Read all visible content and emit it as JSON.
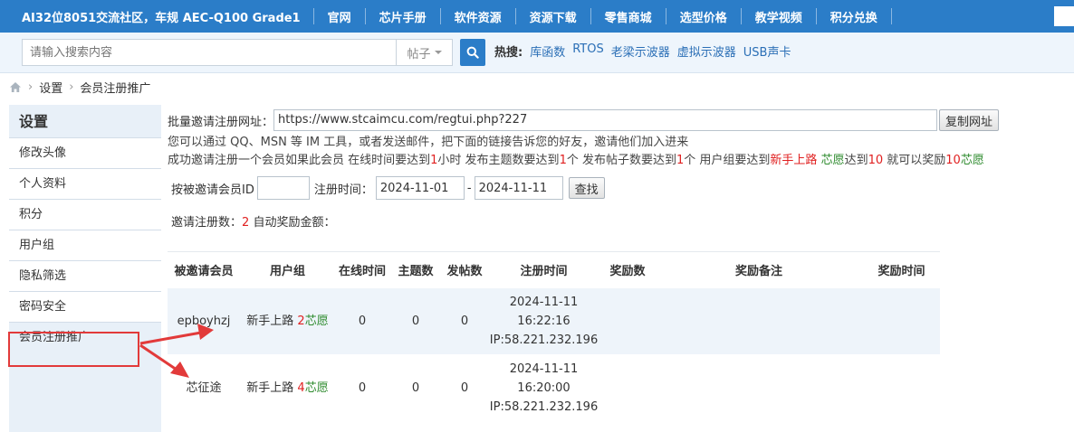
{
  "topnav": {
    "brand": "AI32位8051交流社区，车规 AEC-Q100 Grade1",
    "items": [
      "官网",
      "芯片手册",
      "软件资源",
      "资源下载",
      "零售商城",
      "选型价格",
      "教学视频",
      "积分兑换"
    ]
  },
  "search": {
    "placeholder": "请输入搜索内容",
    "type_selected": "帖子",
    "hot_label": "热搜:",
    "hot_links": [
      "库函数",
      "RTOS",
      "老梁示波器",
      "虚拟示波器",
      "USB声卡"
    ]
  },
  "breadcrumb": {
    "items": [
      "设置",
      "会员注册推广"
    ]
  },
  "sidebar": {
    "title": "设置",
    "items": [
      "修改头像",
      "个人资料",
      "积分",
      "用户组",
      "隐私筛选",
      "密码安全",
      "会员注册推广"
    ]
  },
  "main": {
    "url_label": "批量邀请注册网址：",
    "url_value": "https://www.stcaimcu.com/regtui.php?227",
    "copy_button": "复制网址",
    "desc_line1": "您可以通过 QQ、MSN 等 IM 工具，或者发送邮件，把下面的链接告诉您的好友，邀请他们加入进来",
    "reward": {
      "p1": "成功邀请注册一个会员如果此会员 在线时间要达到",
      "online_hours": "1",
      "p2": "小时 发布主题数要达到",
      "topics": "1",
      "p3": "个 发布帖子数要达到",
      "posts": "1",
      "p4": "个 用户组要达到",
      "group": "新手上路",
      "coin1": "芯愿",
      "p5": "达到",
      "coin_target": "10",
      "p6": " 就可以奖励",
      "reward_amount": "10",
      "coin2": "芯愿"
    },
    "filter": {
      "id_label": "按被邀请会员ID",
      "id_value": "",
      "time_label": "注册时间：",
      "date_from": "2024-11-01",
      "dash": "-",
      "date_to": "2024-11-11",
      "search_button": "查找"
    },
    "invite_count_label": "邀请注册数：",
    "invite_count": "2",
    "auto_reward_label": "自动奖励金额："
  },
  "table": {
    "headers": [
      "被邀请会员",
      "用户组",
      "在线时间",
      "主题数",
      "发帖数",
      "注册时间",
      "奖励数",
      "奖励备注",
      "奖励时间"
    ],
    "rows": [
      {
        "member": "epboyhzj",
        "group": "新手上路",
        "coin_count": "2",
        "coin_name": "芯愿",
        "online": "0",
        "topics": "0",
        "posts": "0",
        "reg_date": "2024-11-11",
        "reg_time": "16:22:16",
        "reg_ip": "IP:58.221.232.196",
        "reward": "",
        "note": "",
        "reward_time": ""
      },
      {
        "member": "芯征途",
        "group": "新手上路",
        "coin_count": "4",
        "coin_name": "芯愿",
        "online": "0",
        "topics": "0",
        "posts": "0",
        "reg_date": "2024-11-11",
        "reg_time": "16:20:00",
        "reg_ip": "IP:58.221.232.196",
        "reward": "",
        "note": "",
        "reward_time": ""
      }
    ]
  },
  "colors": {
    "nav_bg": "#2b7dc8",
    "sidebar_bg": "#e8f0f8",
    "annotation_red": "#e23a3a",
    "value_red": "#e02020",
    "value_green": "#2e8b2e"
  }
}
